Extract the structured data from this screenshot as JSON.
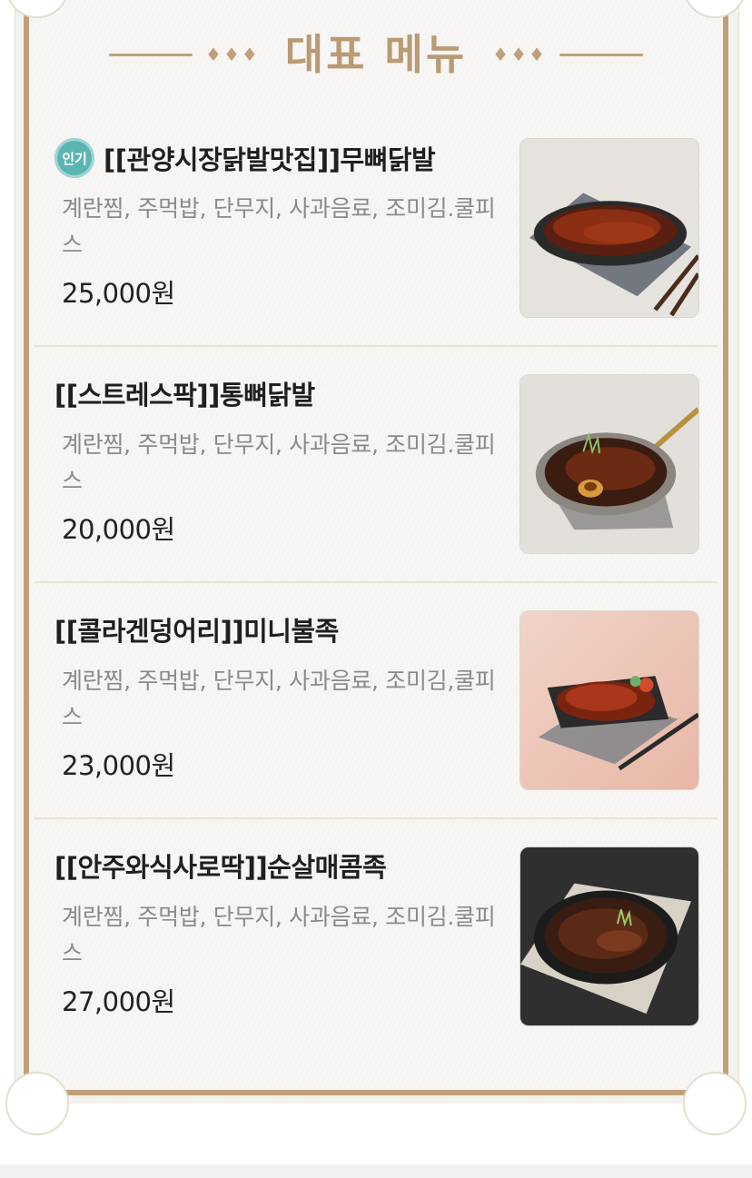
{
  "section": {
    "heading": "대표 메뉴",
    "left_ornament": "♦♦♦",
    "right_ornament": "♦♦♦",
    "accent_color": "#c0a07a"
  },
  "menu": [
    {
      "badge": "인기",
      "name": "[[관양시장닭발맛집]]무뼈닭발",
      "description": "계란찜, 주먹밥, 단무지, 사과음료, 조미김.쿨피스",
      "price": "25,000원",
      "image_icon": "boneless-chicken-feet-photo"
    },
    {
      "badge": "",
      "name": "[[스트레스팍]]통뼈닭발",
      "description": "계란찜, 주먹밥, 단무지, 사과음료, 조미김.쿨피스",
      "price": "20,000원",
      "image_icon": "bone-in-chicken-feet-pan-photo"
    },
    {
      "badge": "",
      "name": "[[콜라겐덩어리]]미니불족",
      "description": "계란찜, 주먹밥, 단무지, 사과음료, 조미김,쿨피스",
      "price": "23,000원",
      "image_icon": "mini-fire-pork-feet-photo"
    },
    {
      "badge": "",
      "name": "[[안주와식사로딱]]순살매콤족",
      "description": "계란찜, 주먹밥, 단무지, 사과음료, 조미김.쿨피스",
      "price": "27,000원",
      "image_icon": "boneless-spicy-pork-feet-photo"
    }
  ]
}
